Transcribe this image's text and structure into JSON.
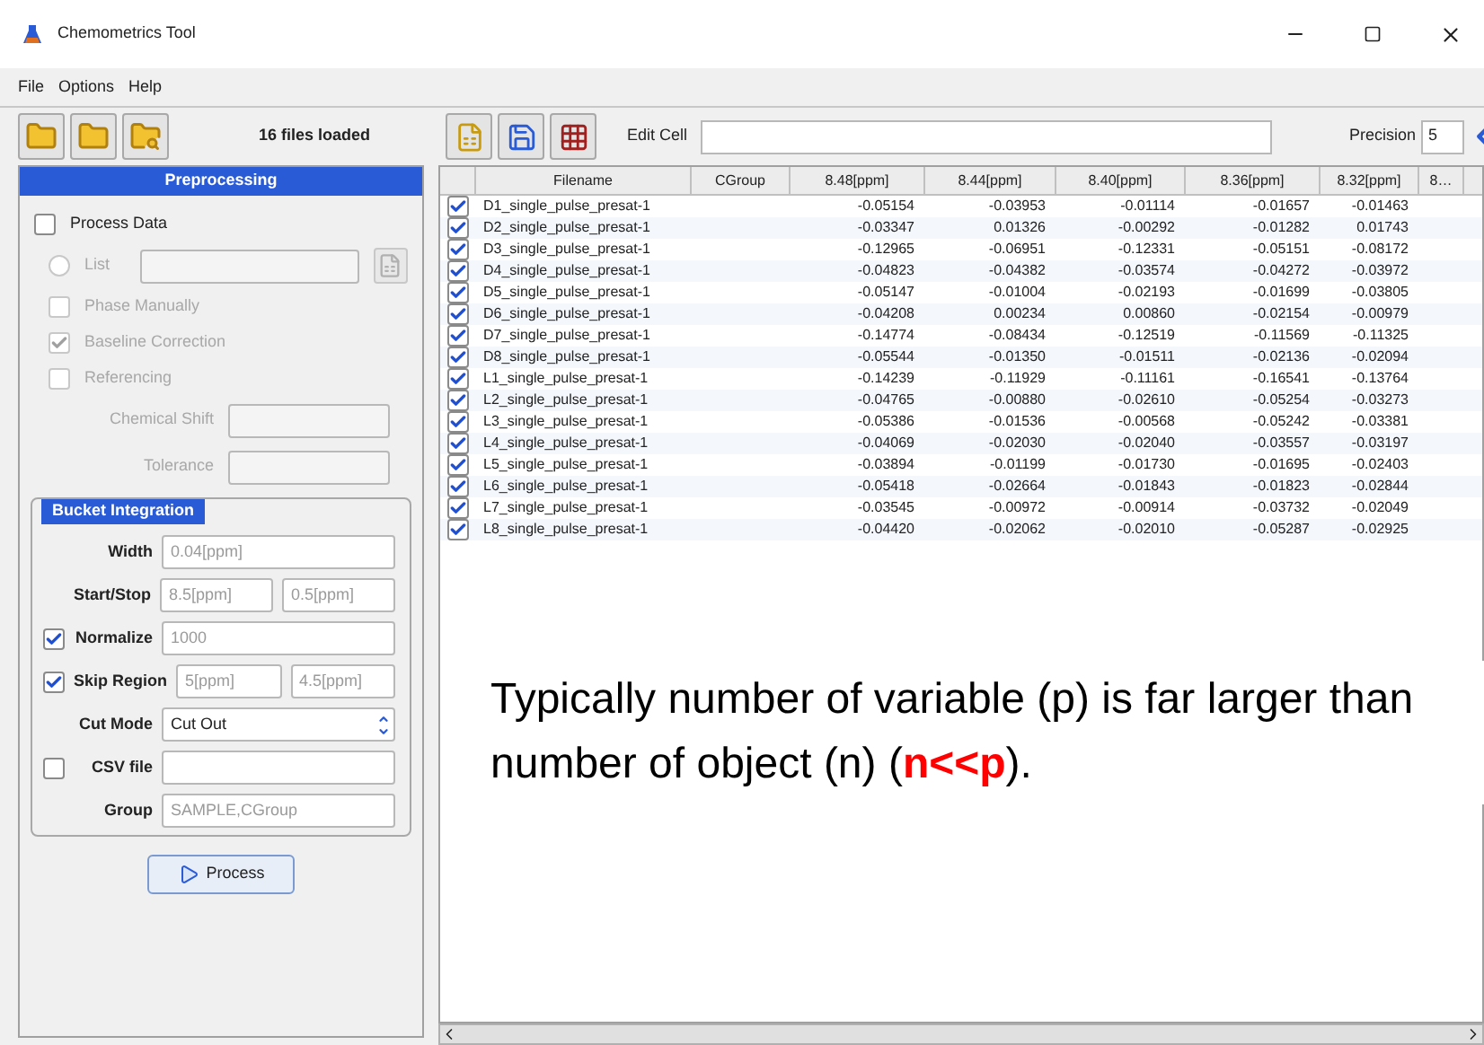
{
  "window": {
    "title": "Chemometrics Tool"
  },
  "menu": [
    "File",
    "Options",
    "Help"
  ],
  "left_toolbar": {
    "status": "16 files loaded"
  },
  "preprocessing": {
    "title": "Preprocessing",
    "options": [
      {
        "kind": "checkbox",
        "label": "Process Data",
        "checked": false,
        "disabled": false
      },
      {
        "kind": "radio-field",
        "label": "List",
        "checked": false,
        "disabled": true
      },
      {
        "kind": "checkbox",
        "label": "Phase Manually",
        "checked": false,
        "disabled": true
      },
      {
        "kind": "checkbox",
        "label": "Baseline Correction",
        "checked": true,
        "disabled": true
      },
      {
        "kind": "checkbox",
        "label": "Referencing",
        "checked": false,
        "disabled": true
      },
      {
        "kind": "field",
        "label": "Chemical Shift",
        "disabled": true
      },
      {
        "kind": "field",
        "label": "Tolerance",
        "disabled": true
      }
    ],
    "bucket": {
      "title": "Bucket Integration",
      "rows": [
        {
          "kind": "field",
          "label": "Width",
          "values": [
            "0.04[ppm]"
          ]
        },
        {
          "kind": "field",
          "label": "Start/Stop",
          "values": [
            "8.5[ppm]",
            "0.5[ppm]"
          ]
        },
        {
          "kind": "check-field",
          "label": "Normalize",
          "checked": true,
          "values": [
            "1000"
          ]
        },
        {
          "kind": "check-field",
          "label": "Skip Region",
          "checked": true,
          "values": [
            "5[ppm]",
            "4.5[ppm]"
          ]
        },
        {
          "kind": "select",
          "label": "Cut Mode",
          "value": "Cut Out"
        },
        {
          "kind": "check-field",
          "label": "CSV file",
          "checked": false
        },
        {
          "kind": "field",
          "label": "Group",
          "values": [
            "SAMPLE,CGroup"
          ]
        }
      ]
    },
    "button": "Process"
  },
  "table_toolbar": {
    "edit_label": "Edit Cell",
    "precision_label": "Precision",
    "precision": "5"
  },
  "table": {
    "columns": [
      "Filename",
      "CGroup",
      "8.48[ppm]",
      "8.44[ppm]",
      "8.40[ppm]",
      "8.36[ppm]",
      "8.32[ppm]",
      "8…"
    ],
    "rows": [
      {
        "checked": true,
        "filename": "D1_single_pulse_presat-1",
        "values": [
          "-0.05154",
          "-0.03953",
          "-0.01114",
          "-0.01657",
          "-0.01463"
        ]
      },
      {
        "checked": true,
        "filename": "D2_single_pulse_presat-1",
        "values": [
          "-0.03347",
          "0.01326",
          "-0.00292",
          "-0.01282",
          "0.01743"
        ]
      },
      {
        "checked": true,
        "filename": "D3_single_pulse_presat-1",
        "values": [
          "-0.12965",
          "-0.06951",
          "-0.12331",
          "-0.05151",
          "-0.08172"
        ]
      },
      {
        "checked": true,
        "filename": "D4_single_pulse_presat-1",
        "values": [
          "-0.04823",
          "-0.04382",
          "-0.03574",
          "-0.04272",
          "-0.03972"
        ]
      },
      {
        "checked": true,
        "filename": "D5_single_pulse_presat-1",
        "values": [
          "-0.05147",
          "-0.01004",
          "-0.02193",
          "-0.01699",
          "-0.03805"
        ]
      },
      {
        "checked": true,
        "filename": "D6_single_pulse_presat-1",
        "values": [
          "-0.04208",
          "0.00234",
          "0.00860",
          "-0.02154",
          "-0.00979"
        ]
      },
      {
        "checked": true,
        "filename": "D7_single_pulse_presat-1",
        "values": [
          "-0.14774",
          "-0.08434",
          "-0.12519",
          "-0.11569",
          "-0.11325"
        ]
      },
      {
        "checked": true,
        "filename": "D8_single_pulse_presat-1",
        "values": [
          "-0.05544",
          "-0.01350",
          "-0.01511",
          "-0.02136",
          "-0.02094"
        ]
      },
      {
        "checked": true,
        "filename": "L1_single_pulse_presat-1",
        "values": [
          "-0.14239",
          "-0.11929",
          "-0.11161",
          "-0.16541",
          "-0.13764"
        ]
      },
      {
        "checked": true,
        "filename": "L2_single_pulse_presat-1",
        "values": [
          "-0.04765",
          "-0.00880",
          "-0.02610",
          "-0.05254",
          "-0.03273"
        ]
      },
      {
        "checked": true,
        "filename": "L3_single_pulse_presat-1",
        "values": [
          "-0.05386",
          "-0.01536",
          "-0.00568",
          "-0.05242",
          "-0.03381"
        ]
      },
      {
        "checked": true,
        "filename": "L4_single_pulse_presat-1",
        "values": [
          "-0.04069",
          "-0.02030",
          "-0.02040",
          "-0.03557",
          "-0.03197"
        ]
      },
      {
        "checked": true,
        "filename": "L5_single_pulse_presat-1",
        "values": [
          "-0.03894",
          "-0.01199",
          "-0.01730",
          "-0.01695",
          "-0.02403"
        ]
      },
      {
        "checked": true,
        "filename": "L6_single_pulse_presat-1",
        "values": [
          "-0.05418",
          "-0.02664",
          "-0.01843",
          "-0.01823",
          "-0.02844"
        ]
      },
      {
        "checked": true,
        "filename": "L7_single_pulse_presat-1",
        "values": [
          "-0.03545",
          "-0.00972",
          "-0.00914",
          "-0.03732",
          "-0.02049"
        ]
      },
      {
        "checked": true,
        "filename": "L8_single_pulse_presat-1",
        "values": [
          "-0.04420",
          "-0.02062",
          "-0.02010",
          "-0.05287",
          "-0.02925"
        ]
      }
    ]
  },
  "annotation": {
    "text": "Typically number of variable (p) is far larger than number of object (n) (**n<<p**)."
  }
}
